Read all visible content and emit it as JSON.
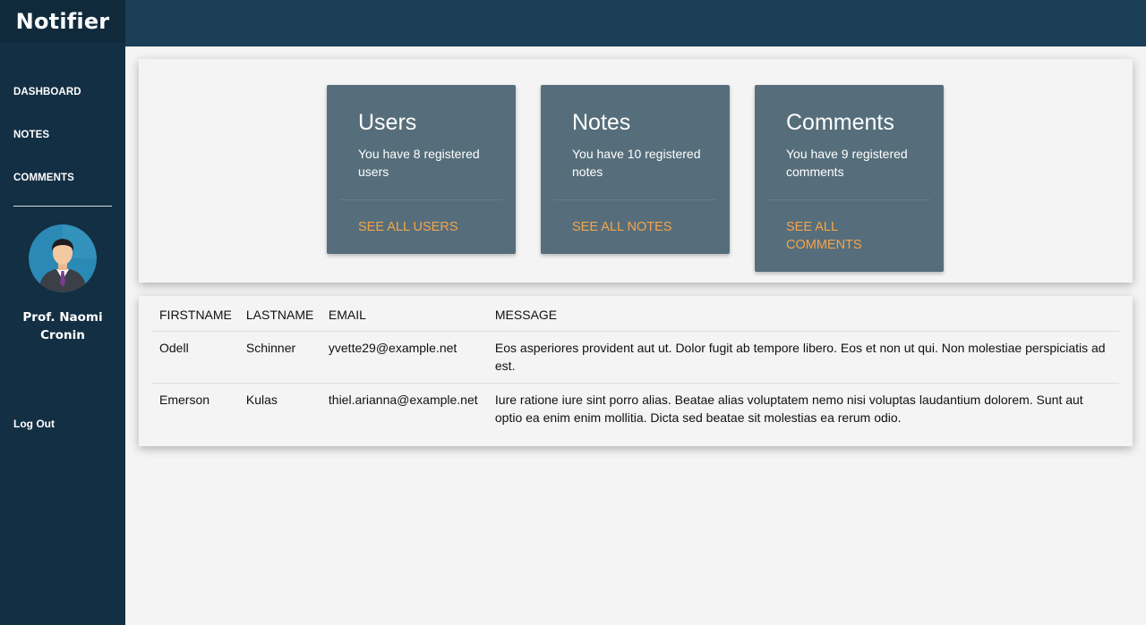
{
  "app": {
    "brand": "Notifier"
  },
  "sidebar": {
    "items": [
      {
        "label": "DASHBOARD"
      },
      {
        "label": "NOTES"
      },
      {
        "label": "COMMENTS"
      }
    ],
    "user_name": "Prof. Naomi Cronin",
    "logout_label": "Log Out"
  },
  "stats": [
    {
      "title": "Users",
      "text": "You have 8 registered users",
      "link": "SEE ALL USERS"
    },
    {
      "title": "Notes",
      "text": "You have 10 registered notes",
      "link": "SEE ALL NOTES"
    },
    {
      "title": "Comments",
      "text": "You have 9 registered comments",
      "link": "SEE ALL COMMENTS"
    }
  ],
  "table": {
    "headers": [
      "FIRSTNAME",
      "LASTNAME",
      "EMAIL",
      "MESSAGE"
    ],
    "rows": [
      {
        "firstname": "Odell",
        "lastname": "Schinner",
        "email": "yvette29@example.net",
        "message": "Eos asperiores provident aut ut. Dolor fugit ab tempore libero. Eos et non ut qui. Non molestiae perspiciatis ad est."
      },
      {
        "firstname": "Emerson",
        "lastname": "Kulas",
        "email": "thiel.arianna@example.net",
        "message": "Iure ratione iure sint porro alias. Beatae alias voluptatem nemo nisi voluptas laudantium dolorem. Sunt aut optio ea enim enim mollitia. Dicta sed beatae sit molestias ea rerum odio."
      }
    ]
  },
  "colors": {
    "sidebar": "#132f43",
    "topbar": "#1b3f57",
    "card": "#566e7b",
    "accent_link": "#f5a44b"
  }
}
